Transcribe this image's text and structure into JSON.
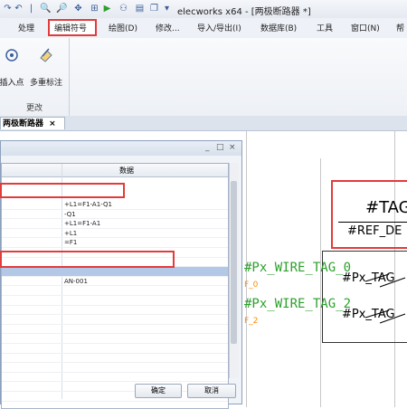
{
  "window": {
    "title": "elecworks x64 - [两极断路器 *]"
  },
  "menu": {
    "items": [
      "处理",
      "编辑符号",
      "绘图(D)",
      "修改...",
      "导入/导出(I)",
      "数据库(B)",
      "工具",
      "窗口(N)",
      "帮"
    ]
  },
  "ribbon": {
    "buttons": [
      {
        "label": "插入点",
        "icon": "insert-point-icon"
      },
      {
        "label": "多重标注",
        "icon": "multi-tag-icon"
      }
    ],
    "group_label": "更改"
  },
  "doc_tab": {
    "label": "两极断路器",
    "close": "×"
  },
  "dialog": {
    "controls": [
      "_",
      "□",
      "×"
    ],
    "column_header": "数据",
    "rows": [
      "+L1=F1-A1-Q1",
      "-Q1",
      "+L1=F1-A1",
      "+L1",
      "=F1",
      "",
      "",
      "",
      "AN-001",
      "",
      "",
      "",
      "",
      "",
      "",
      "",
      "",
      "",
      "",
      "",
      "",
      ""
    ],
    "ok_label": "确定",
    "cancel_label": "取消"
  },
  "drawing": {
    "tag_title": "#TAG",
    "ref_desc": "#REF_DE",
    "wire_tag_0": "#Px_WIRE_TAG_0",
    "wire_tag_2": "#Px_WIRE_TAG_2",
    "f0": "F_0",
    "f2": "F_2",
    "px_tag_1": "#Px_TAG",
    "px_tag_2": "#Px_TAG"
  },
  "colors": {
    "highlight": "#e23b3b",
    "wire": "#2ca02c",
    "function": "#ff8c00",
    "selection": "#b3c8e6"
  }
}
